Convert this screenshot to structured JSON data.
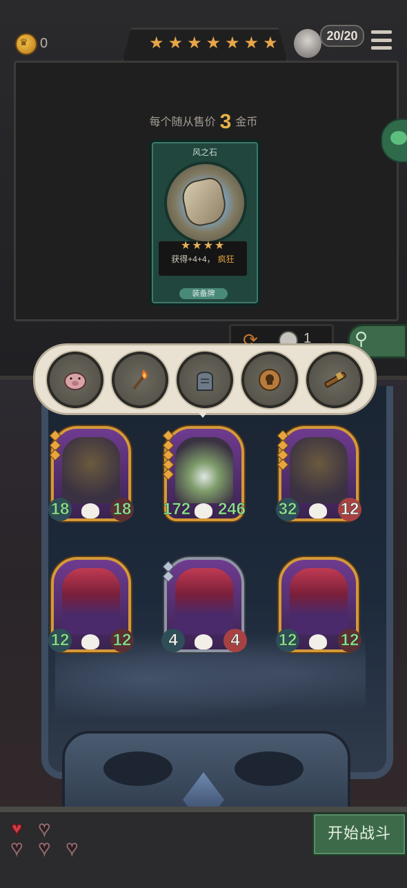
{
  "header": {
    "gold_count": "0",
    "star_count": 7,
    "health_text": "20/20"
  },
  "shop": {
    "sell_text_prefix": "每个随从售价",
    "sell_price": "3",
    "sell_text_suffix": "金币",
    "card": {
      "name": "风之石",
      "stars": 4,
      "desc_prefix": "获得+4+4，",
      "keyword": "疯狂",
      "type": "装备牌"
    },
    "refresh_count": "1"
  },
  "items": [
    {
      "name": "pig-icon"
    },
    {
      "name": "torch-icon"
    },
    {
      "name": "tombstone-icon"
    },
    {
      "name": "skull-map-icon"
    },
    {
      "name": "spyglass-icon"
    }
  ],
  "units": [
    {
      "name": "scarecrow",
      "atk": "18",
      "hp": "18",
      "gems": 3,
      "silver": false,
      "hp_hurt": false
    },
    {
      "name": "ghost-orb",
      "atk": "172",
      "hp": "246",
      "gems": 5,
      "silver": false,
      "hp_hurt": false
    },
    {
      "name": "scarecrow",
      "atk": "32",
      "hp": "12",
      "gems": 4,
      "silver": false,
      "hp_hurt": true
    },
    {
      "name": "clown",
      "atk": "12",
      "hp": "12",
      "gems": 0,
      "silver": false,
      "hp_hurt": false
    },
    {
      "name": "clown",
      "atk": "4",
      "hp": "4",
      "gems": 2,
      "silver": true,
      "hp_hurt": true
    },
    {
      "name": "clown",
      "atk": "12",
      "hp": "12",
      "gems": 0,
      "silver": false,
      "hp_hurt": false
    }
  ],
  "lives": {
    "total": 5,
    "remaining": 1
  },
  "start_button": "开始战斗",
  "colors": {
    "gold": "#e9a548",
    "green_button": "#3d6b4a"
  }
}
